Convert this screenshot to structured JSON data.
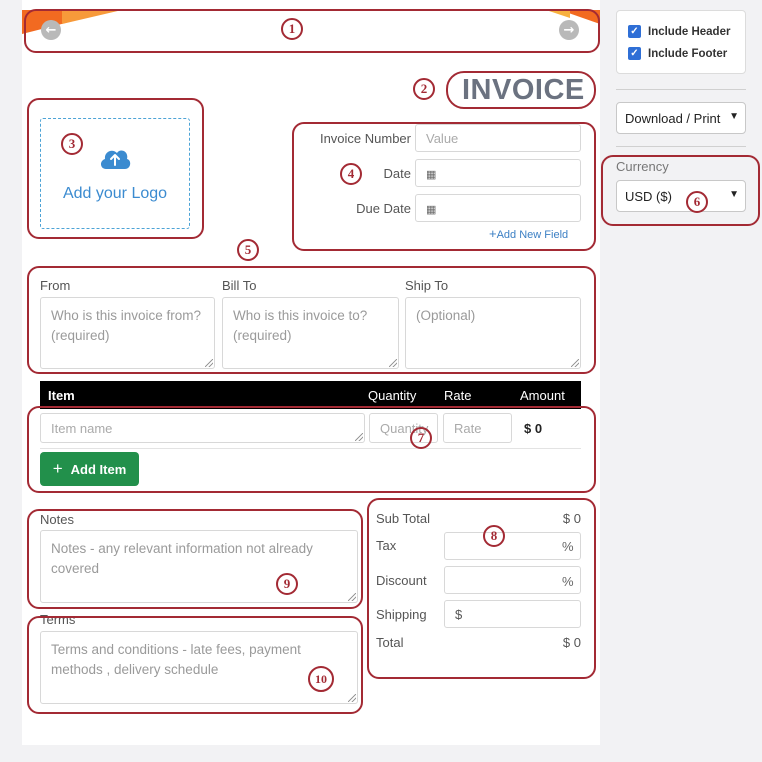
{
  "header": {
    "prev_icon": "arrow-left-icon",
    "next_icon": "arrow-right-icon"
  },
  "title": "INVOICE",
  "logo": {
    "label": "Add your Logo",
    "icon": "cloud-upload-icon"
  },
  "fields": {
    "invoice_number_label": "Invoice Number",
    "invoice_number_placeholder": "Value",
    "date_label": "Date",
    "due_date_label": "Due Date",
    "add_new_field": "Add New Field"
  },
  "parties": {
    "from_label": "From",
    "from_placeholder": "Who is this invoice from? (required)",
    "bill_to_label": "Bill To",
    "bill_to_placeholder": "Who is this invoice to? (required)",
    "ship_to_label": "Ship To",
    "ship_to_placeholder": "(Optional)"
  },
  "items_table": {
    "headers": {
      "item": "Item",
      "quantity": "Quantity",
      "rate": "Rate",
      "amount": "Amount"
    },
    "row": {
      "item_placeholder": "Item name",
      "quantity_placeholder": "Quantity",
      "rate_placeholder": "Rate",
      "amount": "$ 0"
    },
    "add_item_label": "Add Item"
  },
  "notes": {
    "label": "Notes",
    "placeholder": "Notes - any relevant information not already covered"
  },
  "terms": {
    "label": "Terms",
    "placeholder": "Terms and conditions - late fees, payment methods , delivery schedule"
  },
  "summary": {
    "subtotal_label": "Sub Total",
    "subtotal_value": "$ 0",
    "tax_label": "Tax",
    "tax_unit": "%",
    "discount_label": "Discount",
    "discount_unit": "%",
    "shipping_label": "Shipping",
    "shipping_prefix": "$",
    "total_label": "Total",
    "total_value": "$ 0"
  },
  "sidebar": {
    "include_header": "Include Header",
    "include_footer": "Include Footer",
    "download_label": "Download / Print",
    "currency_label": "Currency",
    "currency_value": "USD ($)"
  },
  "annotations": [
    "1",
    "2",
    "3",
    "4",
    "5",
    "6",
    "7",
    "8",
    "9",
    "10"
  ],
  "colors": {
    "annotation": "#a32a34",
    "accent_orange": "#f26a21",
    "add_item_green": "#22904b",
    "link_blue": "#3b7fc4"
  }
}
